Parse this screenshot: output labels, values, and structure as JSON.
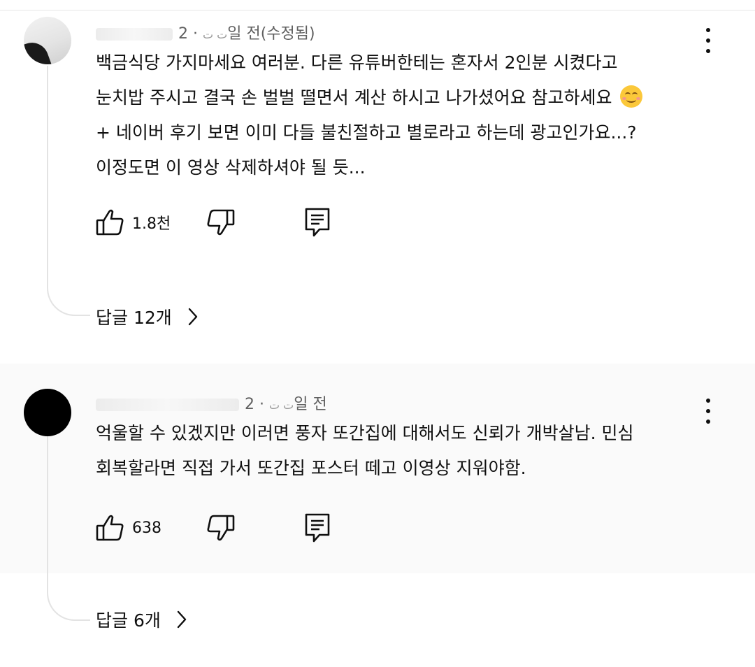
{
  "comments": [
    {
      "author": "ت ت",
      "time": "· 2일 전(수정됨)",
      "lines": [
        "백금식당 가지마세요 여러분. 다른 유튜버한테는 혼자서 2인분 시켰다고",
        "눈치밥 주시고 결국 손 벌벌 떨면서 계산 하시고 나가셨어요 참고하세요",
        "+ 네이버 후기 보면 이미 다들 불친절하고 별로라고 하는데 광고인가요...?",
        "이정도면 이 영상 삭제하셔야 될 듯..."
      ],
      "emoji": "smiling-face-emoji",
      "likes": "1.8천",
      "replies": "답글 12개"
    },
    {
      "author": "ت ت",
      "time": "· 2일 전",
      "lines": [
        "억울할 수 있겠지만 이러면 풍자 또간집에 대해서도 신뢰가 개박살남. 민심",
        "회복할라면 직접 가서 또간집 포스터 떼고 이영상 지워야함."
      ],
      "likes": "638",
      "replies": "답글 6개"
    }
  ],
  "icons": {
    "like": "thumbs-up-icon",
    "dislike": "thumbs-down-icon",
    "reply": "reply-icon",
    "menu": "more-vert-icon",
    "chevron": "chevron-right-icon"
  },
  "colors": {
    "text": "#0f0f0f",
    "meta": "#606060",
    "thread_line": "#e3e3e3",
    "highlight_bg": "#fafafa"
  }
}
